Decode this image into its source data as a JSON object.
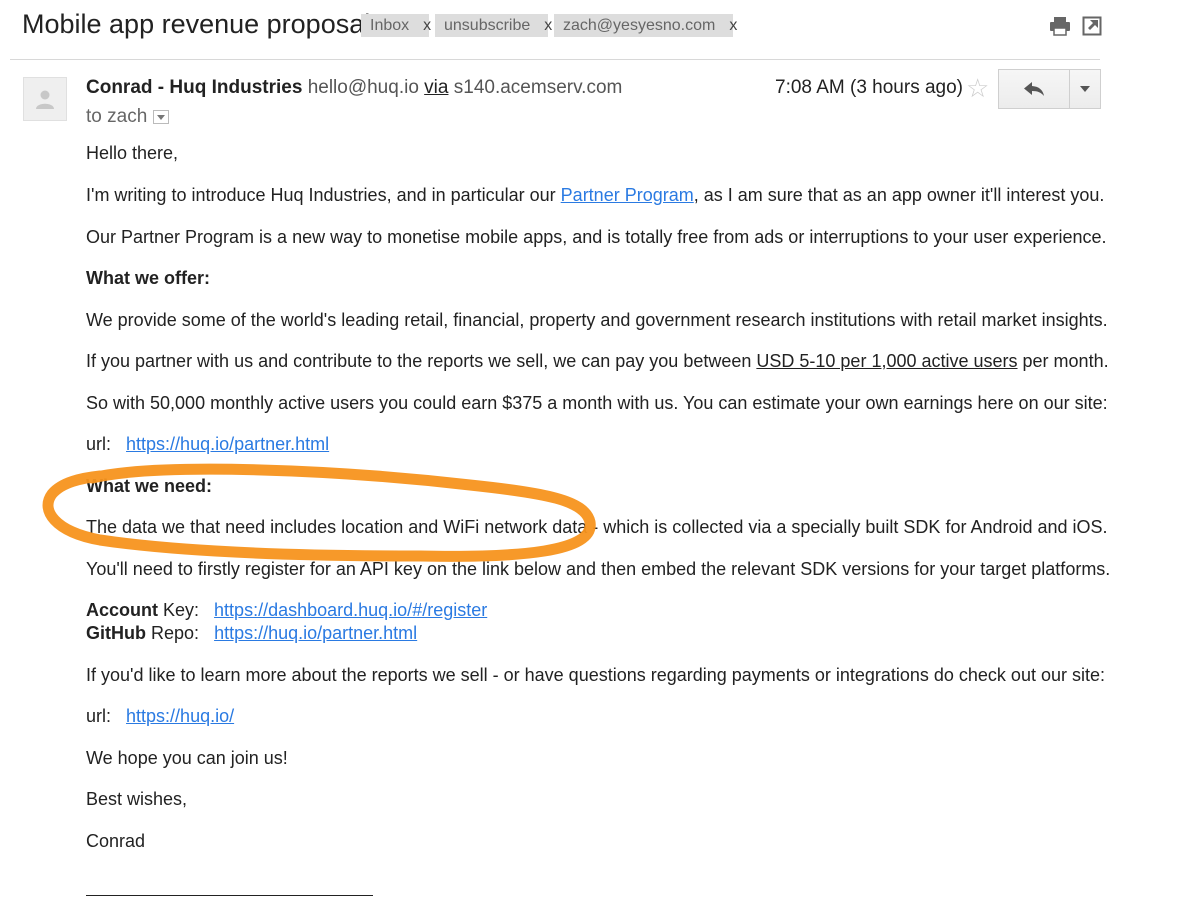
{
  "subject": "Mobile app revenue proposal",
  "labels": [
    {
      "text": "Inbox",
      "close": "x"
    },
    {
      "text": "unsubscribe",
      "close": "x"
    },
    {
      "text": "zach@yesyesno.com",
      "close": "x"
    }
  ],
  "header_icons": [
    "print-icon",
    "new-window-icon"
  ],
  "sender": {
    "name": "Conrad - Huq Industries",
    "email": "hello@huq.io",
    "via_word": "via",
    "via_host": "s140.acemserv.com",
    "to": "to zach",
    "time": "7:08 AM (3 hours ago)"
  },
  "body": {
    "greeting": "Hello there,",
    "intro_pre": "I'm writing to introduce Huq Industries, and in particular our ",
    "intro_link": "Partner Program",
    "intro_post": ", as I am sure that as an app owner it'll interest you.",
    "p2": "Our Partner Program is a new way to monetise mobile apps, and is totally free from ads or interruptions to your user experience.",
    "offer_heading": "What we offer:",
    "p3": "We provide some of the world's leading retail, financial, property and government research institutions with retail market insights.",
    "p4_pre": "If you partner with us and contribute to the reports we sell, we can pay you between ",
    "p4_underline": "USD 5-10 per 1,000 active users",
    "p4_post": " per month.",
    "p5": "So with 50,000 monthly active users you could earn $375 a month with us. You can estimate your own earnings here on our site:",
    "url_label": "url:",
    "url1": "https://huq.io/partner.html",
    "need_heading": "What we need:",
    "p6": "The data we that need includes location and WiFi network data - which is collected via a specially built SDK for Android and iOS.",
    "p7": "You'll need to firstly register for an API key on the link below and then embed the relevant SDK versions for your target platforms.",
    "account_bold": "Account",
    "account_rest": " Key:",
    "account_link": "https://dashboard.huq.io/#/register",
    "github_bold": "GitHub",
    "github_rest": " Repo:",
    "github_link": "https://huq.io/partner.html",
    "p8": "If you'd like to learn more about the reports we sell - or have questions regarding payments or integrations do check out our site:",
    "url2_label": "url:",
    "url2": "https://huq.io/",
    "p9": "We hope you can join us!",
    "closing": "Best wishes,",
    "signoff": "Conrad"
  },
  "colors": {
    "link": "#2a7ae2",
    "label_bg": "#dddddd",
    "annotation": "#f7941d"
  }
}
